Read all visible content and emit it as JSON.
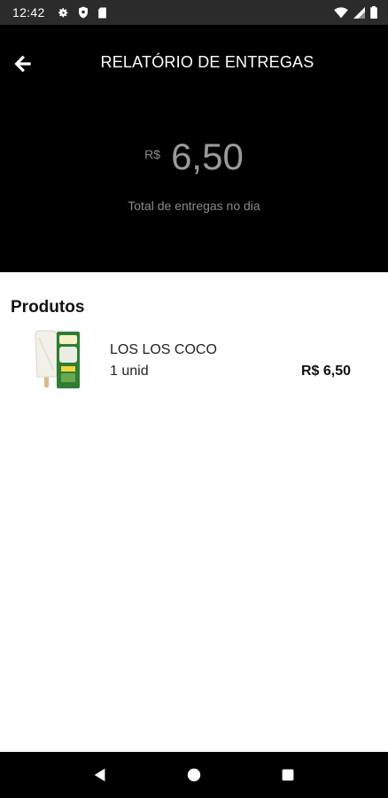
{
  "status_bar": {
    "time": "12:42",
    "icons": [
      "gear-icon",
      "shield-icon",
      "sd-card-icon",
      "wifi-icon",
      "signal-icon",
      "battery-icon"
    ]
  },
  "header": {
    "title": "RELATÓRIO DE ENTREGAS",
    "back_icon": "arrow-left-icon",
    "currency": "R$",
    "total": "6,50",
    "caption": "Total de entregas no dia"
  },
  "products": {
    "title": "Produtos",
    "items": [
      {
        "name": "LOS LOS COCO",
        "quantity": "1 unid",
        "price": "R$ 6,50"
      }
    ]
  },
  "nav": {
    "icons": [
      "back-triangle-icon",
      "home-circle-icon",
      "recents-square-icon"
    ]
  },
  "colors": {
    "header_bg": "#000000",
    "status_bg": "#2b2b2b",
    "text_muted": "#8a8a8a",
    "product_green": "#2e7d32"
  }
}
